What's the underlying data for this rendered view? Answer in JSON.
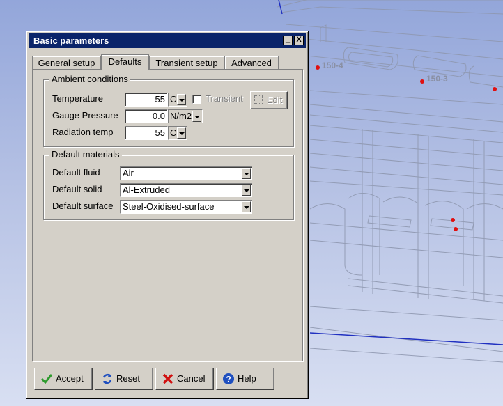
{
  "background": {
    "labels": [
      "150-4",
      "150-3"
    ]
  },
  "window": {
    "title": "Basic parameters",
    "minimize_glyph": "_",
    "close_glyph": "X"
  },
  "tabs": [
    {
      "label": "General setup",
      "active": false
    },
    {
      "label": "Defaults",
      "active": true
    },
    {
      "label": "Transient setup",
      "active": false
    },
    {
      "label": "Advanced",
      "active": false
    }
  ],
  "ambient": {
    "title": "Ambient conditions",
    "temperature": {
      "label": "Temperature",
      "value": "55",
      "unit": "C"
    },
    "transient": {
      "label": "Transient",
      "checked": false
    },
    "edit_label": "Edit",
    "gauge_pressure": {
      "label": "Gauge Pressure",
      "value": "0.0",
      "unit": "N/m2"
    },
    "radiation_temp": {
      "label": "Radiation temp",
      "value": "55",
      "unit": "C"
    }
  },
  "materials": {
    "title": "Default materials",
    "fluid": {
      "label": "Default fluid",
      "value": "Air"
    },
    "solid": {
      "label": "Default solid",
      "value": "Al-Extruded"
    },
    "surface": {
      "label": "Default surface",
      "value": "Steel-Oxidised-surface"
    }
  },
  "buttons": {
    "accept": "Accept",
    "reset": "Reset",
    "cancel": "Cancel",
    "help": "Help"
  },
  "colors": {
    "title_bar": "#0a246a",
    "dialog_bg": "#d4d0c8",
    "accept_icon": "#2e9b2e",
    "cancel_icon": "#d01010",
    "help_icon": "#1f4fbf",
    "marker": "#e01010"
  }
}
